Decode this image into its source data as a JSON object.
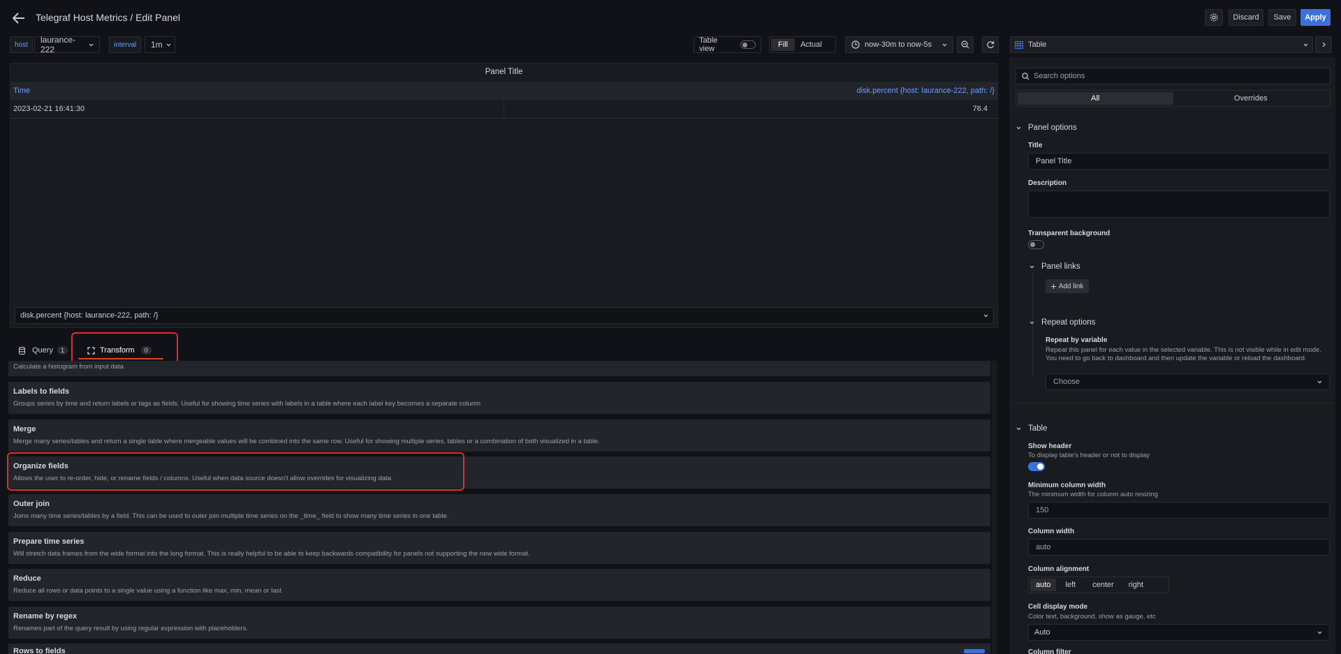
{
  "header": {
    "title": "Telegraf Host Metrics / Edit Panel",
    "discard": "Discard",
    "save": "Save",
    "apply": "Apply"
  },
  "toolbar": {
    "host_label": "host",
    "host_value": "laurance-222",
    "interval_label": "interval",
    "interval_value": "1m",
    "table_view": "Table view",
    "fill": "Fill",
    "actual": "Actual",
    "time_range": "now-30m to now-5s"
  },
  "panel": {
    "title": "Panel Title",
    "col_time": "Time",
    "col_value": "disk.percent {host: laurance-222, path: /}",
    "row_time": "2023-02-21 16:41:30",
    "row_value": "76.4",
    "series_select": "disk.percent {host: laurance-222, path: /}"
  },
  "tabs": {
    "query": "Query",
    "query_count": "1",
    "transform": "Transform",
    "transform_count": "0"
  },
  "transforms": {
    "partial_desc": "Calculate a histogram from input data",
    "items": [
      {
        "title": "Labels to fields",
        "desc": "Groups series by time and return labels or tags as fields. Useful for showing time series with labels in a table where each label key becomes a separate column"
      },
      {
        "title": "Merge",
        "desc": "Merge many series/tables and return a single table where mergeable values will be combined into the same row. Useful for showing multiple series, tables or a combination of both visualized in a table."
      },
      {
        "title": "Organize fields",
        "desc": "Allows the user to re-order, hide, or rename fields / columns. Useful when data source doesn't allow overrides for visualizing data."
      },
      {
        "title": "Outer join",
        "desc": "Joins many time series/tables by a field. This can be used to outer join multiple time series on the _time_ field to show many time series in one table."
      },
      {
        "title": "Prepare time series",
        "desc": "Will stretch data frames from the wide format into the long format. This is really helpful to be able to keep backwards compatibility for panels not supporting the new wide format."
      },
      {
        "title": "Reduce",
        "desc": "Reduce all rows or data points to a single value using a function like max, min, mean or last"
      },
      {
        "title": "Rename by regex",
        "desc": "Renames part of the query result by using regular expression with placeholders."
      }
    ],
    "partial_last": "Rows to fields"
  },
  "options": {
    "viz": "Table",
    "search_placeholder": "Search options",
    "tab_all": "All",
    "tab_overrides": "Overrides",
    "panel_options": "Panel options",
    "title_label": "Title",
    "title_value": "Panel Title",
    "description_label": "Description",
    "transparent_label": "Transparent background",
    "panel_links": "Panel links",
    "add_link": "Add link",
    "repeat_options": "Repeat options",
    "repeat_by_label": "Repeat by variable",
    "repeat_by_desc": "Repeat this panel for each value in the selected variable. This is not visible while in edit mode. You need to go back to dashboard and then update the variable or reload the dashboard.",
    "choose": "Choose",
    "table_section": "Table",
    "show_header": "Show header",
    "show_header_desc": "To display table's header or not to display",
    "min_col_width": "Minimum column width",
    "min_col_width_desc": "The minimum width for column auto resizing",
    "min_col_width_value": "150",
    "col_width": "Column width",
    "col_width_value": "auto",
    "col_align": "Column alignment",
    "align_auto": "auto",
    "align_left": "left",
    "align_center": "center",
    "align_right": "right",
    "cell_mode": "Cell display mode",
    "cell_mode_desc": "Color text, background, show as gauge, etc",
    "cell_mode_value": "Auto",
    "partial_next": "Column filter"
  },
  "colors": {
    "accent": "#3d71d9",
    "link": "#6e9fff",
    "highlight": "#e02f2f"
  }
}
